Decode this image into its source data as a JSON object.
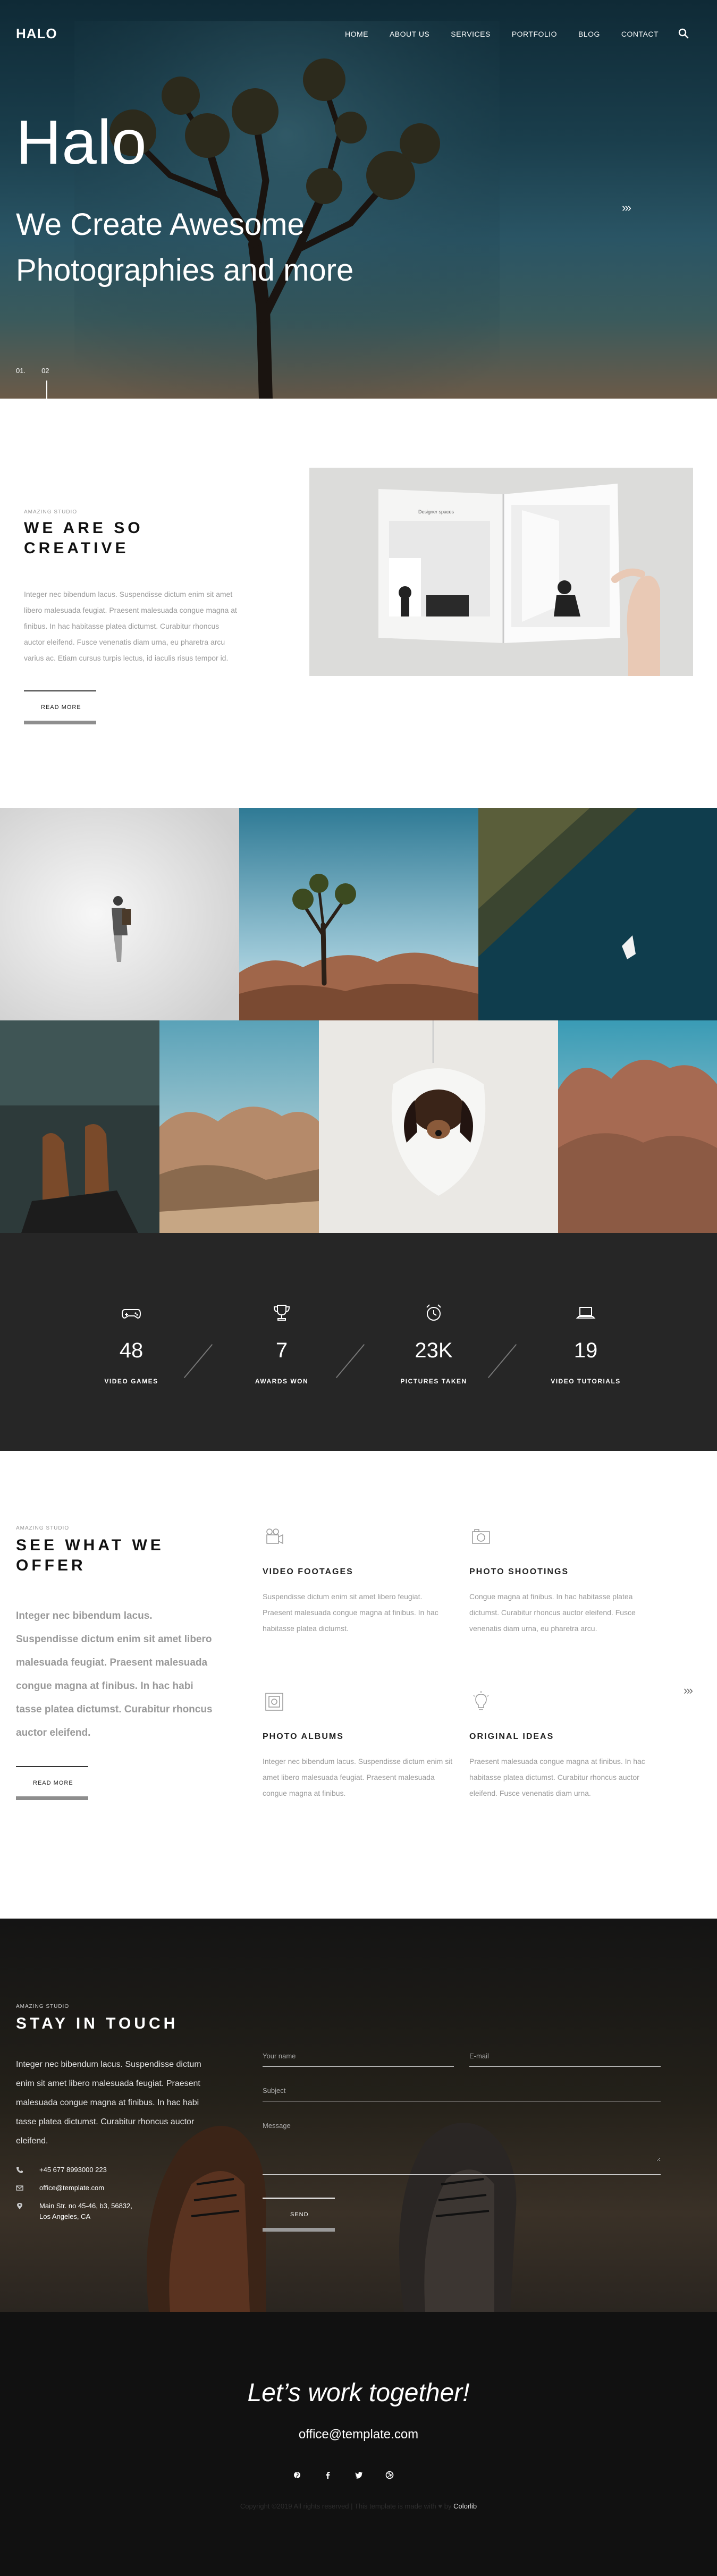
{
  "header": {
    "logo": "HALO",
    "nav": [
      "HOME",
      "ABOUT US",
      "SERVICES",
      "PORTFOLIO",
      "BLOG",
      "CONTACT"
    ]
  },
  "hero": {
    "title": "Halo",
    "subtitle": "We Create Awesome Photographies and more",
    "next_label": "›››",
    "slide_1": "01.",
    "slide_2": "02"
  },
  "about": {
    "eyebrow": "AMAZING STUDIO",
    "heading": "WE ARE SO CREATIVE",
    "body": "Integer nec bibendum lacus. Suspendisse dictum enim sit amet libero malesuada feugiat. Praesent malesuada congue magna at finibus. In hac habitasse platea dictumst. Curabitur rhoncus auctor eleifend. Fusce venenatis diam urna, eu pharetra arcu varius ac. Etiam cursus turpis lectus, id iaculis risus tempor id.",
    "cta": "READ MORE",
    "book_left_title": "Designer spaces"
  },
  "stats": [
    {
      "icon": "gamepad-icon",
      "value": "48",
      "label": "VIDEO GAMES"
    },
    {
      "icon": "trophy-icon",
      "value": "7",
      "label": "AWARDS WON"
    },
    {
      "icon": "alarm-clock-icon",
      "value": "23K",
      "label": "PICTURES TAKEN"
    },
    {
      "icon": "laptop-icon",
      "value": "19",
      "label": "VIDEO TUTORIALS"
    }
  ],
  "services": {
    "eyebrow": "AMAZING STUDIO",
    "heading": "SEE WHAT WE OFFER",
    "lead": "Integer nec bibendum lacus. Suspendisse dictum enim sit amet libero malesuada feugiat. Praesent malesuada congue magna at finibus. In hac habi tasse platea dictumst. Curabitur rhoncus auctor eleifend.",
    "cta": "READ MORE",
    "next_label": "›››",
    "items": [
      {
        "icon": "video-camera-icon",
        "title": "VIDEO FOOTAGES",
        "text": "Suspendisse dictum enim sit amet libero feugiat. Praesent malesuada congue magna at finibus. In hac habitasse platea dictumst."
      },
      {
        "icon": "photo-camera-icon",
        "title": "PHOTO SHOOTINGS",
        "text": "Congue magna at finibus. In hac habitasse platea dictumst. Curabitur rhoncus auctor eleifend. Fusce venenatis diam urna, eu pharetra arcu."
      },
      {
        "icon": "photo-album-icon",
        "title": "PHOTO ALBUMS",
        "text": "Integer nec bibendum lacus. Suspendisse dictum enim sit amet libero malesuada feugiat. Praesent malesuada congue magna at finibus."
      },
      {
        "icon": "lightbulb-icon",
        "title": "ORIGINAL IDEAS",
        "text": "Praesent malesuada congue magna at finibus. In hac habitasse platea dictumst. Curabitur rhoncus auctor eleifend. Fusce venenatis diam urna."
      }
    ]
  },
  "contact": {
    "eyebrow": "AMAZING STUDIO",
    "heading": "STAY IN TOUCH",
    "lead": "Integer nec bibendum lacus. Suspendisse dictum enim sit amet libero malesuada feugiat. Praesent malesuada congue magna at finibus. In hac habi tasse platea dictumst. Curabitur rhoncus auctor eleifend.",
    "phone": "+45 677 8993000 223",
    "email": "office@template.com",
    "address_1": "Main Str. no 45-46, b3, 56832,",
    "address_2": "Los Angeles, CA",
    "form": {
      "name_placeholder": "Your name",
      "email_placeholder": "E-mail",
      "subject_placeholder": "Subject",
      "message_placeholder": "Message",
      "send": "SEND"
    }
  },
  "footer": {
    "tagline": "Let’s work together!",
    "email": "office@template.com",
    "socials": [
      "pinterest-icon",
      "facebook-icon",
      "twitter-icon",
      "dribbble-icon"
    ],
    "copyright": "Copyright ©2019 All rights reserved | This template is made with ♥ by",
    "credit": "Colorlib"
  },
  "colors": {
    "dark": "#262626",
    "footer": "#111111",
    "muted_text": "#9a9a9a"
  }
}
